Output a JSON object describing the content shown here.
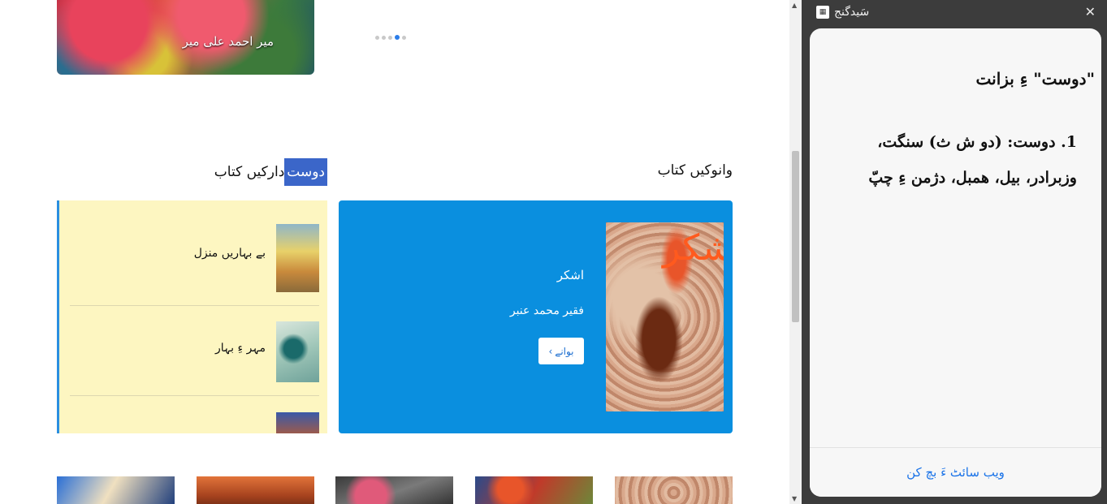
{
  "hero": {
    "cover_author": "میر احمد علی میر"
  },
  "carousel": {
    "dot_count": 5,
    "active_index": 3
  },
  "sections": {
    "new_books": "وانوکیں کتاب",
    "friend_books_highlight": "دوست",
    "friend_books_rest": "دارکیں کتاب"
  },
  "featured": {
    "cover_text": "اشکر",
    "title": "اشکر",
    "author": "فقیر محمد عنبر",
    "read_button": "بوانے",
    "read_button_icon": "chevron-right-icon"
  },
  "list": [
    {
      "title": "بے بہاریں منزل"
    },
    {
      "title": "مہر ءِ بہار"
    },
    {
      "title": ""
    }
  ],
  "sidepanel": {
    "title": "سَیدگنج",
    "word_heading": "\"دوست\" ءِ بزانت",
    "definition": "1. دوست: (دو ش ث) سنگت، وزبرادر، بیل، ھمبل، دژمن ءِ چپّ",
    "footer_link": "ویب سائٹ ءَ بچ کن",
    "close_icon": "close-icon"
  },
  "colors": {
    "accent": "#0a8fdf",
    "highlight": "#3b66c9",
    "list_bg": "#fdf6c1",
    "link": "#1a73e8"
  }
}
